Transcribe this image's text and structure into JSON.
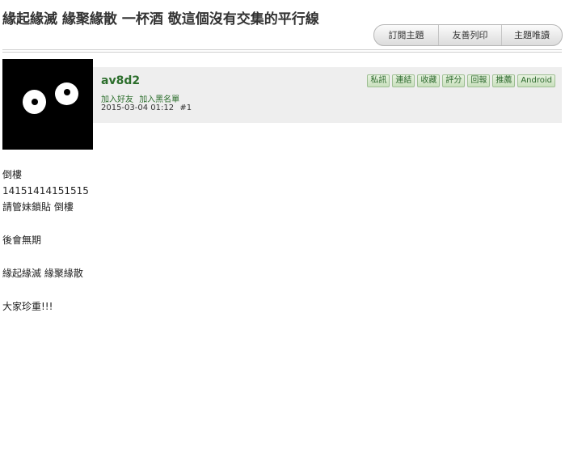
{
  "topic": {
    "title": "緣起緣滅 緣聚緣散 一杯酒 敬這個沒有交集的平行線"
  },
  "toolbar": {
    "buttons": [
      "訂閱主題",
      "友善列印",
      "主題唯讀"
    ]
  },
  "post": {
    "username": "av8d2",
    "add_friend": "加入好友",
    "add_blacklist": "加入黑名單",
    "datetime": "2015-03-04 01:12",
    "floor": "#1",
    "actions": [
      "私訊",
      "連結",
      "收藏",
      "評分",
      "回報",
      "推薦",
      "Android"
    ],
    "body": [
      "倒樓",
      "14151414151515",
      "請管妹鎖貼 倒樓",
      "後會無期",
      "緣起緣滅 緣聚緣散",
      "大家珍重!!!"
    ]
  }
}
